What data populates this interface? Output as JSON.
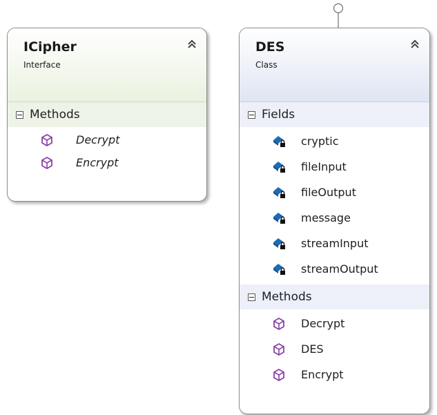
{
  "shapes": {
    "icipher": {
      "name": "ICipher",
      "kind": "Interface",
      "sections": [
        {
          "title": "Methods",
          "members": [
            "Decrypt",
            "Encrypt"
          ]
        }
      ]
    },
    "des": {
      "name": "DES",
      "kind": "Class",
      "sections": [
        {
          "title": "Fields",
          "members": [
            "cryptic",
            "fileInput",
            "fileOutput",
            "message",
            "streamInput",
            "streamOutput"
          ]
        },
        {
          "title": "Methods",
          "members": [
            "Decrypt",
            "DES",
            "Encrypt"
          ]
        }
      ]
    }
  },
  "icons": {
    "collapse": "double-chevron-up-icon",
    "field": "private-field-icon",
    "method": "method-icon",
    "lollipop": "interface-lollipop-icon"
  },
  "colors": {
    "interface_header": "#eaf2e0",
    "class_header": "#dfe5f2",
    "method_icon": "#8a3fa8",
    "field_icon": "#1c6bb5"
  }
}
